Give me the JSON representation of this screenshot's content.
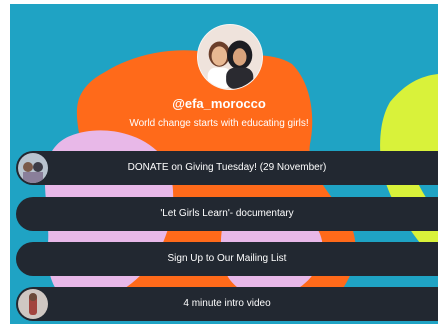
{
  "profile": {
    "handle": "@efa_morocco",
    "tagline": "World change starts with educating girls!"
  },
  "links": [
    {
      "label": "DONATE on Giving Tuesday! (29 November)",
      "has_thumbnail": true
    },
    {
      "label": "'Let Girls Learn'- documentary",
      "has_thumbnail": false
    },
    {
      "label": "Sign Up to Our Mailing List",
      "has_thumbnail": false
    },
    {
      "label": "4 minute intro video",
      "has_thumbnail": true
    }
  ],
  "colors": {
    "background": "#1fa3c4",
    "orange_shape": "#ff6a1a",
    "pink_shape": "#e8b8e8",
    "yellow_shape": "#d9f23a",
    "button": "#222831",
    "text": "#ffffff"
  }
}
